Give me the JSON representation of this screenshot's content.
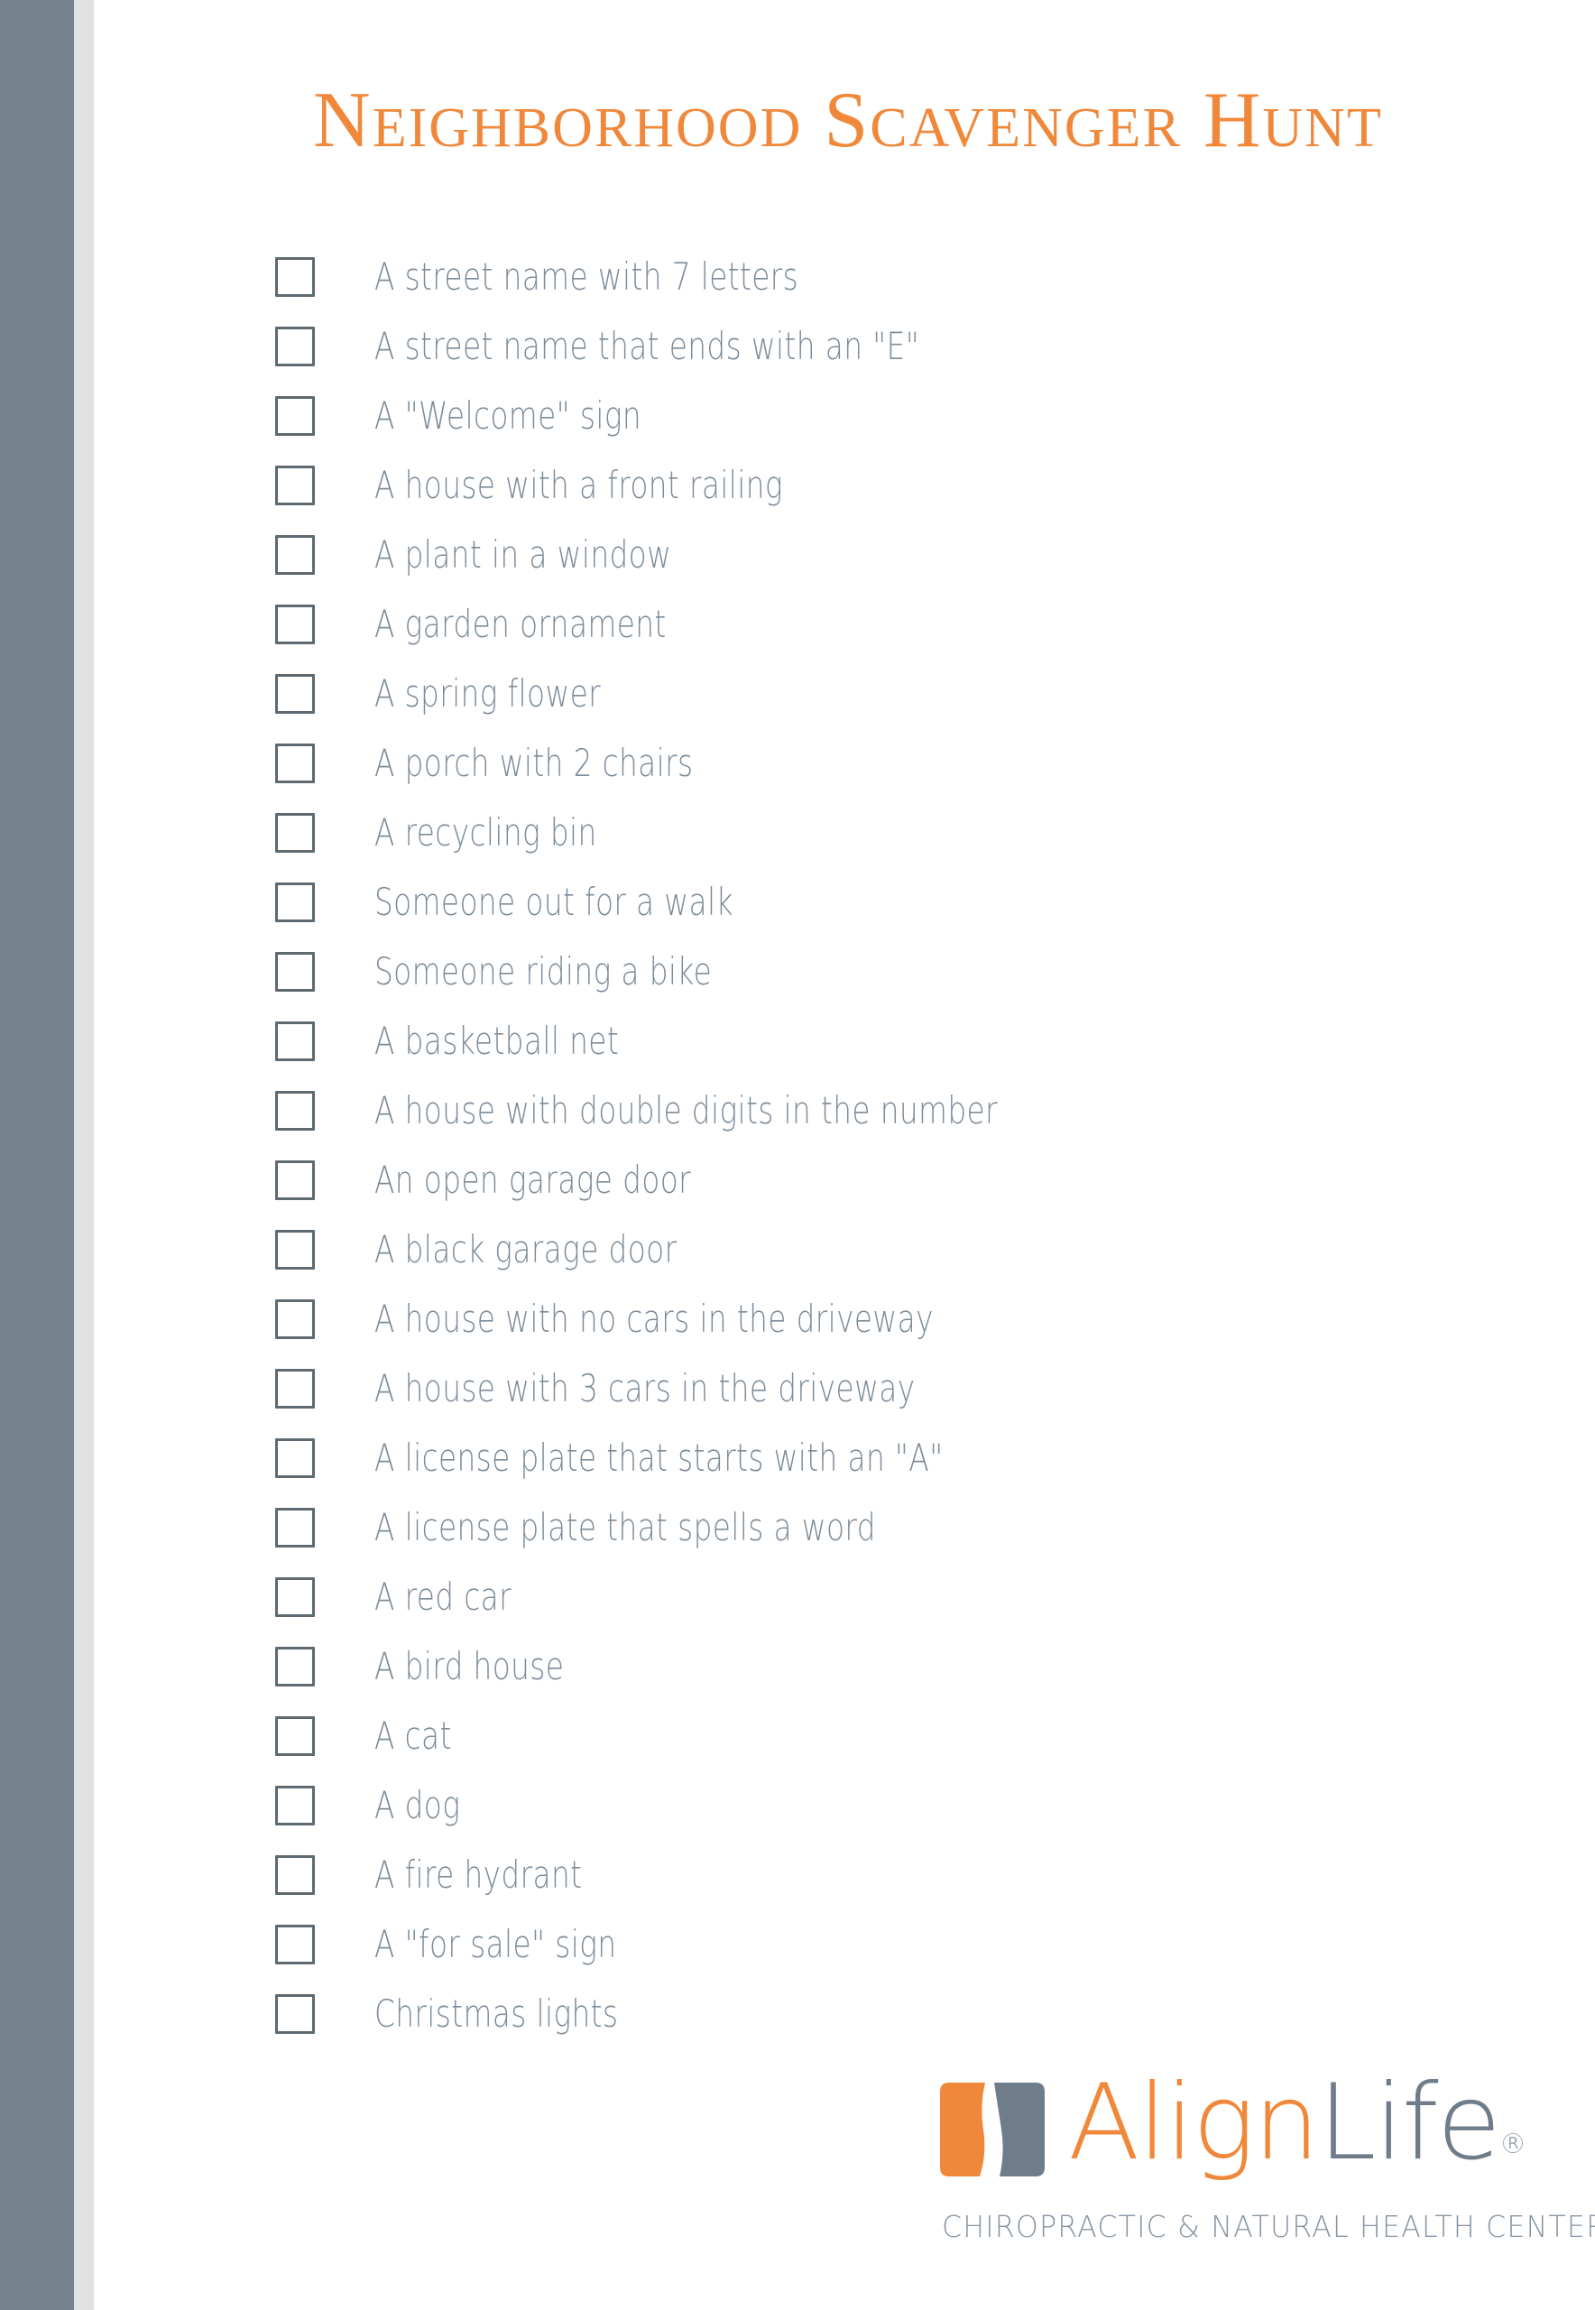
{
  "page": {
    "title": "Neighborhood Scavenger Hunt",
    "accent_orange": "#F0883B",
    "accent_gray_blue": "#76838F",
    "text_color": "#7D8C9A",
    "sidebar_color": "#76838F",
    "sidebar_light_color": "#DFE1E3"
  },
  "checklist": {
    "items": [
      {
        "label": "A street name with 7 letters",
        "checked": false
      },
      {
        "label": "A street name that ends with an \"E\"",
        "checked": false
      },
      {
        "label": "A \"Welcome\" sign",
        "checked": false
      },
      {
        "label": "A house with a front railing",
        "checked": false
      },
      {
        "label": "A plant in a window",
        "checked": false
      },
      {
        "label": "A garden ornament",
        "checked": false
      },
      {
        "label": "A spring flower",
        "checked": false
      },
      {
        "label": "A porch with 2 chairs",
        "checked": false
      },
      {
        "label": "A recycling bin",
        "checked": false
      },
      {
        "label": "Someone out for a walk",
        "checked": false
      },
      {
        "label": "Someone riding a bike",
        "checked": false
      },
      {
        "label": "A basketball net",
        "checked": false
      },
      {
        "label": "A house with double digits in the number",
        "checked": false
      },
      {
        "label": "An open garage door",
        "checked": false
      },
      {
        "label": "A black garage door",
        "checked": false
      },
      {
        "label": "A house with no cars in the driveway",
        "checked": false
      },
      {
        "label": "A house with 3 cars in the driveway",
        "checked": false
      },
      {
        "label": "A license plate that starts with an \"A\"",
        "checked": false
      },
      {
        "label": "A license plate that spells a word",
        "checked": false
      },
      {
        "label": "A red car",
        "checked": false
      },
      {
        "label": "A bird house",
        "checked": false
      },
      {
        "label": "A cat",
        "checked": false
      },
      {
        "label": "A dog",
        "checked": false
      },
      {
        "label": "A fire hydrant",
        "checked": false
      },
      {
        "label": "A \"for sale\" sign",
        "checked": false
      },
      {
        "label": "Christmas lights",
        "checked": false
      }
    ]
  },
  "logo": {
    "word_primary": "Align",
    "word_secondary": "Life",
    "registered_mark": "®",
    "tagline": "CHIROPRACTIC & NATURAL HEALTH CENTER",
    "mark_orange": "#F0883B",
    "mark_gray": "#6F7D8A"
  }
}
